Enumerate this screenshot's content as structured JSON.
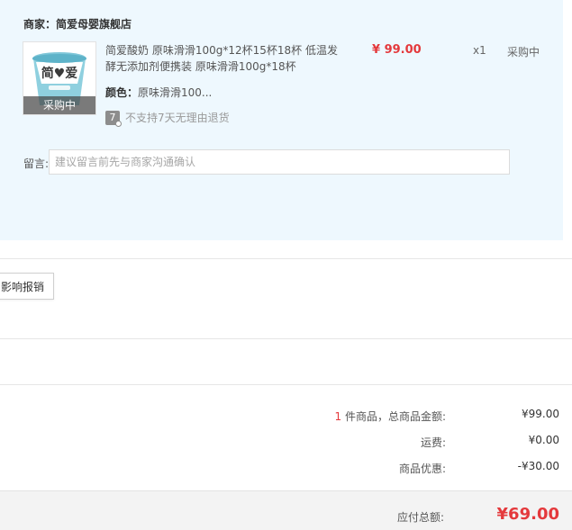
{
  "order": {
    "merchant": "商家：简爱母婴旗舰店",
    "item": {
      "title": "简爱酸奶 原味滑滑100g*12杯15杯18杯 低温发酵无添加剂便携装 原味滑滑100g*18杯",
      "color_label": "颜色：",
      "color_value": "原味滑滑100...",
      "no_return_badge": "7",
      "no_return_text": "不支持7天无理由退货",
      "price": "¥ 99.00",
      "quantity": "x1",
      "status": "采购中",
      "thumb_overlay": "采购中",
      "thumb_brand": "简♥爱"
    },
    "memo": {
      "label": "留言:",
      "placeholder": "建议留言前先与商家沟通确认"
    }
  },
  "reimburse_button": "影响报销",
  "summary": {
    "count": "1",
    "count_suffix": " 件商品，总商品金额:",
    "goods_amount": "¥99.00",
    "shipping_label": "运费:",
    "shipping_amount": "¥0.00",
    "discount_label": "商品优惠:",
    "discount_amount": "-¥30.00"
  },
  "total": {
    "label": "应付总额:",
    "amount": "¥69.00"
  },
  "colors": {
    "card_bg": "#eef8fe",
    "accent_red": "#e4393c",
    "total_bar_bg": "#f3f3f3"
  }
}
